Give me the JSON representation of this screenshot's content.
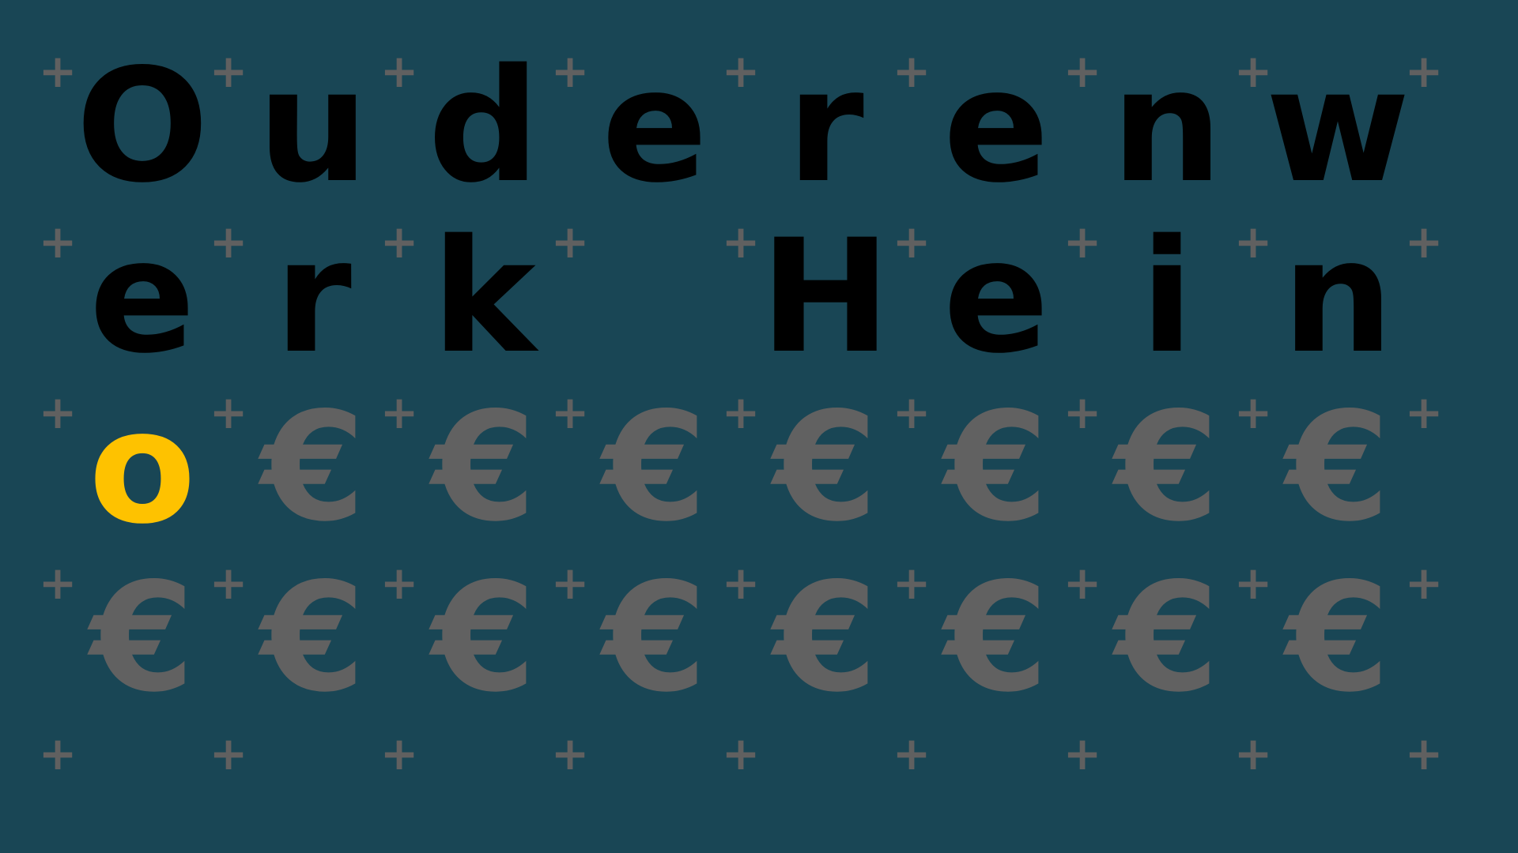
{
  "grid": {
    "rows": [
      [
        "O",
        "u",
        "d",
        "e",
        "r",
        "e",
        "n",
        "w"
      ],
      [
        "e",
        "r",
        "k",
        "",
        "H",
        "e",
        "i",
        "n"
      ],
      [
        "o",
        "€",
        "€",
        "€",
        "€",
        "€",
        "€",
        "€"
      ],
      [
        "€",
        "€",
        "€",
        "€",
        "€",
        "€",
        "€",
        "€"
      ]
    ],
    "highlight": {
      "row": 2,
      "col": 0
    },
    "filler_char": "€"
  },
  "plus_marker": {
    "symbol": "+",
    "rows": 5,
    "cols": 9
  },
  "colors": {
    "background": "#194655",
    "letter": "#000000",
    "highlight": "#fec200",
    "filler": "#616161",
    "plus": "#606060"
  }
}
